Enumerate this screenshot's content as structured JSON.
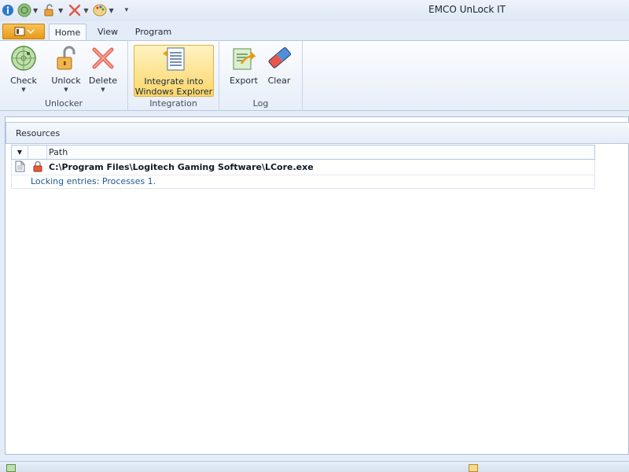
{
  "window": {
    "title": "EMCO UnLock IT"
  },
  "quick_access": {
    "items": [
      "info-icon",
      "check-icon",
      "unlock-icon",
      "delete-icon",
      "palette-icon"
    ]
  },
  "tabs": [
    {
      "label": "Home",
      "active": true
    },
    {
      "label": "View",
      "active": false
    },
    {
      "label": "Program",
      "active": false
    }
  ],
  "ribbon": {
    "groups": [
      {
        "label": "Unlocker",
        "buttons": [
          {
            "label": "Check",
            "icon": "radar-icon"
          },
          {
            "label": "Unlock",
            "icon": "padlock-icon"
          },
          {
            "label": "Delete",
            "icon": "delete-x-icon"
          }
        ]
      },
      {
        "label": "Integration",
        "buttons": [
          {
            "label": "Integrate into Windows Explorer",
            "icon": "explorer-integration-icon"
          }
        ]
      },
      {
        "label": "Log",
        "buttons": [
          {
            "label": "Export",
            "icon": "export-icon"
          },
          {
            "label": "Clear",
            "icon": "eraser-icon"
          }
        ]
      }
    ]
  },
  "resources": {
    "title": "Resources",
    "columns": {
      "path": "Path"
    },
    "rows": [
      {
        "path": "C:\\Program Files\\Logitech Gaming Software\\LCore.exe",
        "detail": "Locking entries: Processes 1."
      }
    ]
  },
  "colors": {
    "accent_orange": "#e89a14",
    "ribbon_highlight": "#fbd66a",
    "detail_text": "#1d5a8f"
  }
}
